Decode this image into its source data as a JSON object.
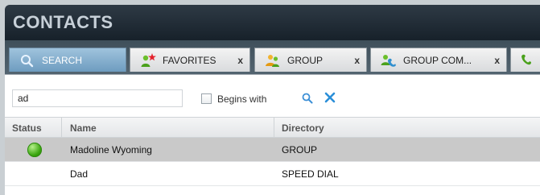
{
  "header": {
    "title": "CONTACTS"
  },
  "tabs": [
    {
      "label": "SEARCH",
      "icon": "search-icon",
      "active": true,
      "closable": false
    },
    {
      "label": "FAVORITES",
      "icon": "favorites-icon",
      "active": false,
      "closable": true,
      "close_label": "x"
    },
    {
      "label": "GROUP",
      "icon": "group-icon",
      "active": false,
      "closable": true,
      "close_label": "x"
    },
    {
      "label": "GROUP COM...",
      "icon": "group-common-icon",
      "active": false,
      "closable": true,
      "close_label": "x"
    }
  ],
  "search": {
    "value": "ad",
    "begins_with_label": "Begins with",
    "begins_with_checked": false
  },
  "table": {
    "columns": [
      "Status",
      "Name",
      "Directory"
    ],
    "rows": [
      {
        "status": "online",
        "name": "Madoline Wyoming",
        "directory": "GROUP",
        "selected": true
      },
      {
        "status": "",
        "name": "Dad",
        "directory": "SPEED DIAL",
        "selected": false
      }
    ]
  },
  "colors": {
    "title_bar": "#17212a",
    "active_tab": "#6e9cc0",
    "selected_row": "#c9c9c9",
    "presence_online": "#3aa50f"
  }
}
